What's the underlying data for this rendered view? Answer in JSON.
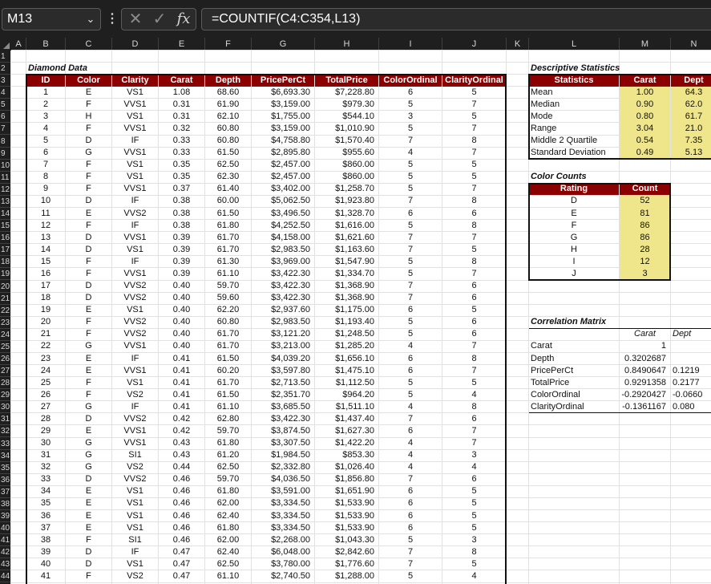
{
  "formula_bar": {
    "name_box": "M13",
    "formula": "=COUNTIF(C4:C354,L13)",
    "fx_label": "fx"
  },
  "columns": [
    "A",
    "B",
    "C",
    "D",
    "E",
    "F",
    "G",
    "H",
    "I",
    "J",
    "K",
    "L",
    "M",
    "N"
  ],
  "diamond": {
    "title": "Diamond Data",
    "headers": [
      "ID",
      "Color",
      "Clarity",
      "Carat",
      "Depth",
      "PricePerCt",
      "TotalPrice",
      "ColorOrdinal",
      "ClarityOrdinal"
    ],
    "rows": [
      [
        "1",
        "E",
        "VS1",
        "1.08",
        "68.60",
        "$6,693.30",
        "$7,228.80",
        "6",
        "5"
      ],
      [
        "2",
        "F",
        "VVS1",
        "0.31",
        "61.90",
        "$3,159.00",
        "$979.30",
        "5",
        "7"
      ],
      [
        "3",
        "H",
        "VS1",
        "0.31",
        "62.10",
        "$1,755.00",
        "$544.10",
        "3",
        "5"
      ],
      [
        "4",
        "F",
        "VVS1",
        "0.32",
        "60.80",
        "$3,159.00",
        "$1,010.90",
        "5",
        "7"
      ],
      [
        "5",
        "D",
        "IF",
        "0.33",
        "60.80",
        "$4,758.80",
        "$1,570.40",
        "7",
        "8"
      ],
      [
        "6",
        "G",
        "VVS1",
        "0.33",
        "61.50",
        "$2,895.80",
        "$955.60",
        "4",
        "7"
      ],
      [
        "7",
        "F",
        "VS1",
        "0.35",
        "62.50",
        "$2,457.00",
        "$860.00",
        "5",
        "5"
      ],
      [
        "8",
        "F",
        "VS1",
        "0.35",
        "62.30",
        "$2,457.00",
        "$860.00",
        "5",
        "5"
      ],
      [
        "9",
        "F",
        "VVS1",
        "0.37",
        "61.40",
        "$3,402.00",
        "$1,258.70",
        "5",
        "7"
      ],
      [
        "10",
        "D",
        "IF",
        "0.38",
        "60.00",
        "$5,062.50",
        "$1,923.80",
        "7",
        "8"
      ],
      [
        "11",
        "E",
        "VVS2",
        "0.38",
        "61.50",
        "$3,496.50",
        "$1,328.70",
        "6",
        "6"
      ],
      [
        "12",
        "F",
        "IF",
        "0.38",
        "61.80",
        "$4,252.50",
        "$1,616.00",
        "5",
        "8"
      ],
      [
        "13",
        "D",
        "VVS1",
        "0.39",
        "61.70",
        "$4,158.00",
        "$1,621.60",
        "7",
        "7"
      ],
      [
        "14",
        "D",
        "VS1",
        "0.39",
        "61.70",
        "$2,983.50",
        "$1,163.60",
        "7",
        "5"
      ],
      [
        "15",
        "F",
        "IF",
        "0.39",
        "61.30",
        "$3,969.00",
        "$1,547.90",
        "5",
        "8"
      ],
      [
        "16",
        "F",
        "VVS1",
        "0.39",
        "61.10",
        "$3,422.30",
        "$1,334.70",
        "5",
        "7"
      ],
      [
        "17",
        "D",
        "VVS2",
        "0.40",
        "59.70",
        "$3,422.30",
        "$1,368.90",
        "7",
        "6"
      ],
      [
        "18",
        "D",
        "VVS2",
        "0.40",
        "59.60",
        "$3,422.30",
        "$1,368.90",
        "7",
        "6"
      ],
      [
        "19",
        "E",
        "VS1",
        "0.40",
        "62.20",
        "$2,937.60",
        "$1,175.00",
        "6",
        "5"
      ],
      [
        "20",
        "F",
        "VVS2",
        "0.40",
        "60.80",
        "$2,983.50",
        "$1,193.40",
        "5",
        "6"
      ],
      [
        "21",
        "F",
        "VVS2",
        "0.40",
        "61.70",
        "$3,121.20",
        "$1,248.50",
        "5",
        "6"
      ],
      [
        "22",
        "G",
        "VVS1",
        "0.40",
        "61.70",
        "$3,213.00",
        "$1,285.20",
        "4",
        "7"
      ],
      [
        "23",
        "E",
        "IF",
        "0.41",
        "61.50",
        "$4,039.20",
        "$1,656.10",
        "6",
        "8"
      ],
      [
        "24",
        "E",
        "VVS1",
        "0.41",
        "60.20",
        "$3,597.80",
        "$1,475.10",
        "6",
        "7"
      ],
      [
        "25",
        "F",
        "VS1",
        "0.41",
        "61.70",
        "$2,713.50",
        "$1,112.50",
        "5",
        "5"
      ],
      [
        "26",
        "F",
        "VS2",
        "0.41",
        "61.50",
        "$2,351.70",
        "$964.20",
        "5",
        "4"
      ],
      [
        "27",
        "G",
        "IF",
        "0.41",
        "61.10",
        "$3,685.50",
        "$1,511.10",
        "4",
        "8"
      ],
      [
        "28",
        "D",
        "VVS2",
        "0.42",
        "62.80",
        "$3,422.30",
        "$1,437.40",
        "7",
        "6"
      ],
      [
        "29",
        "E",
        "VVS1",
        "0.42",
        "59.70",
        "$3,874.50",
        "$1,627.30",
        "6",
        "7"
      ],
      [
        "30",
        "G",
        "VVS1",
        "0.43",
        "61.80",
        "$3,307.50",
        "$1,422.20",
        "4",
        "7"
      ],
      [
        "31",
        "G",
        "SI1",
        "0.43",
        "61.20",
        "$1,984.50",
        "$853.30",
        "4",
        "3"
      ],
      [
        "32",
        "G",
        "VS2",
        "0.44",
        "62.50",
        "$2,332.80",
        "$1,026.40",
        "4",
        "4"
      ],
      [
        "33",
        "D",
        "VVS2",
        "0.46",
        "59.70",
        "$4,036.50",
        "$1,856.80",
        "7",
        "6"
      ],
      [
        "34",
        "E",
        "VS1",
        "0.46",
        "61.80",
        "$3,591.00",
        "$1,651.90",
        "6",
        "5"
      ],
      [
        "35",
        "E",
        "VS1",
        "0.46",
        "62.00",
        "$3,334.50",
        "$1,533.90",
        "6",
        "5"
      ],
      [
        "36",
        "E",
        "VS1",
        "0.46",
        "62.40",
        "$3,334.50",
        "$1,533.90",
        "6",
        "5"
      ],
      [
        "37",
        "E",
        "VS1",
        "0.46",
        "61.80",
        "$3,334.50",
        "$1,533.90",
        "6",
        "5"
      ],
      [
        "38",
        "F",
        "SI1",
        "0.46",
        "62.00",
        "$2,268.00",
        "$1,043.30",
        "5",
        "3"
      ],
      [
        "39",
        "D",
        "IF",
        "0.47",
        "62.40",
        "$6,048.00",
        "$2,842.60",
        "7",
        "8"
      ],
      [
        "40",
        "D",
        "VS1",
        "0.47",
        "62.50",
        "$3,780.00",
        "$1,776.60",
        "7",
        "5"
      ],
      [
        "41",
        "F",
        "VS2",
        "0.47",
        "61.10",
        "$2,740.50",
        "$1,288.00",
        "5",
        "4"
      ]
    ]
  },
  "descriptive": {
    "title": "Descriptive Statistics",
    "headers": [
      "Statistics",
      "Carat",
      "Dept"
    ],
    "rows": [
      [
        "Mean",
        "1.00",
        "64.3"
      ],
      [
        "Median",
        "0.90",
        "62.0"
      ],
      [
        "Mode",
        "0.80",
        "61.7"
      ],
      [
        "Range",
        "3.04",
        "21.0"
      ],
      [
        "Middle 2 Quartile",
        "0.54",
        "7.35"
      ],
      [
        "Standard Deviation",
        "0.49",
        "5.13"
      ]
    ]
  },
  "color_counts": {
    "title": "Color Counts",
    "headers": [
      "Rating",
      "Count"
    ],
    "rows": [
      [
        "D",
        "52"
      ],
      [
        "E",
        "81"
      ],
      [
        "F",
        "86"
      ],
      [
        "G",
        "86"
      ],
      [
        "H",
        "28"
      ],
      [
        "I",
        "12"
      ],
      [
        "J",
        "3"
      ]
    ]
  },
  "correlation": {
    "title": "Correlation Matrix",
    "headers": [
      "Carat",
      "Dept"
    ],
    "rows": [
      [
        "Carat",
        "1",
        ""
      ],
      [
        "Depth",
        "0.3202687",
        ""
      ],
      [
        "PricePerCt",
        "0.8490647",
        "0.1219"
      ],
      [
        "TotalPrice",
        "0.9291358",
        "0.2177"
      ],
      [
        "ColorOrdinal",
        "-0.2920427",
        "-0.0660"
      ],
      [
        "ClarityOrdinal",
        "-0.1361167",
        "0.080"
      ]
    ]
  }
}
